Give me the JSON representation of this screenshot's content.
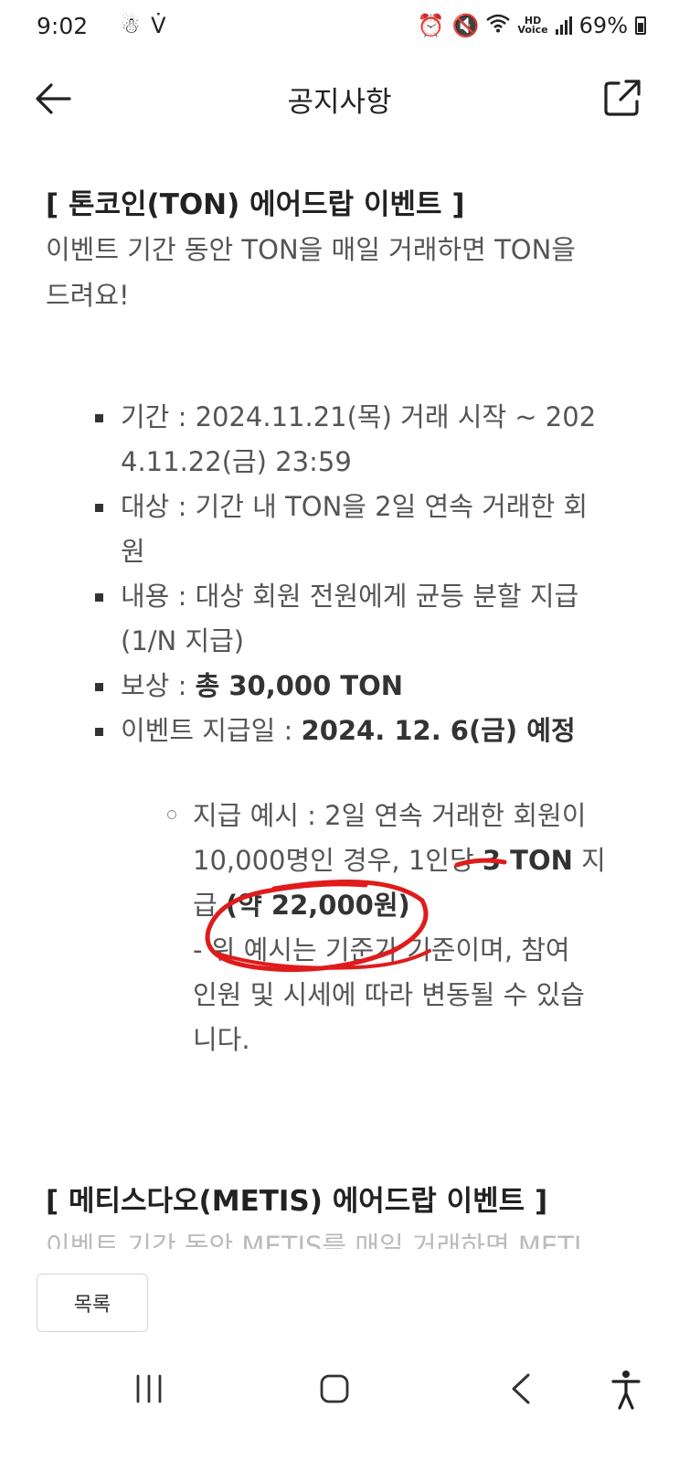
{
  "status_bar": {
    "time": "9:02",
    "left_icons": [
      "notification-icon",
      "app-notification-icon"
    ],
    "right_icons": [
      "alarm-icon",
      "mute-icon",
      "wifi-icon",
      "hd-voice-icon",
      "signal-icon"
    ],
    "hd_voice": "HD",
    "battery": "69%"
  },
  "header": {
    "title": "공지사항",
    "back_icon": "arrow-left-icon",
    "share_icon": "share-external-icon"
  },
  "notice": {
    "title": "[ 톤코인(TON) 에어드랍 이벤트 ]",
    "intro_line1": "이벤트 기간 동안 TON을 매일 거래하면 TON을",
    "intro_line2": "드려요!",
    "bullets": {
      "period_line1": "기간 : 2024.11.21(목) 거래 시작 ~ 202",
      "period_line2": "4.11.22(금) 23:59",
      "target_line1": "대상 : 기간 내 TON을 2일 연속 거래한 회",
      "target_line2": "원",
      "content_line1": "내용 : 대상 회원 전원에게 균등 분할 지급",
      "content_line2": "(1/N 지급)",
      "reward_label": "보상 : ",
      "reward_value": "총 30,000 TON",
      "paydate_label": "이벤트 지급일 : ",
      "paydate_value": "2024. 12. 6(금) 예정"
    },
    "example": {
      "line1": "지급 예시 : 2일 연속 거래한 회원이",
      "line2_plain": "10,000명인 경우, 1인당 ",
      "line2_bold": "3 TON",
      "line2_end": " 지",
      "line3_plain": "급 ",
      "line3_bold": "(약 22,000원)",
      "line4": "- 위 예시는 기준가 기준이며, 참여",
      "line5": "인원 및 시세에 따라 변동될 수 있습",
      "line6": "니다."
    }
  },
  "next_notice": {
    "title": "[ 메티스다오(METIS) 에어드랍 이벤트 ]",
    "intro_partial": "이벤트 기간 동안 METIS를 매일 거래하면 METI"
  },
  "list_button_label": "목록",
  "nav_bar": {
    "recent_icon": "recent-apps-icon",
    "home_icon": "home-icon",
    "back_icon": "back-icon",
    "accessibility_icon": "accessibility-icon"
  },
  "annotation_color": "#e01b1b"
}
